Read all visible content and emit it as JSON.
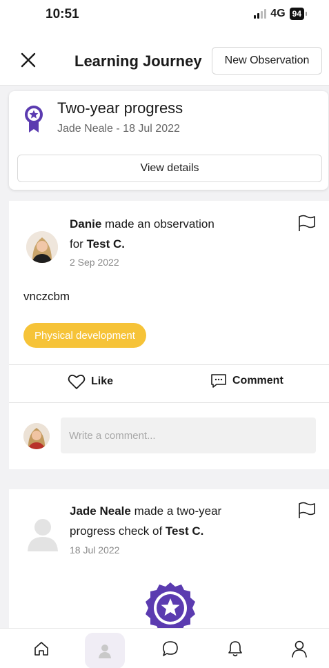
{
  "status_bar": {
    "time": "10:51",
    "network": "4G",
    "battery": "94"
  },
  "header": {
    "title": "Learning Journey",
    "new_observation_label": "New Observation"
  },
  "progress_card": {
    "title": "Two-year progress",
    "subtitle": "Jade Neale - 18 Jul 2022",
    "view_details_label": "View details"
  },
  "observation": {
    "author": "Danie",
    "action_text": " made an observation",
    "for_text": "for ",
    "child": "Test C.",
    "date": "2 Sep 2022",
    "text": "vnczcbm",
    "tag": "Physical development",
    "like_label": "Like",
    "comment_label": "Comment",
    "comment_placeholder": "Write a comment..."
  },
  "progress_check": {
    "author": "Jade Neale",
    "action_text": " made a two-year",
    "line2_text": "progress check of ",
    "child": "Test C.",
    "date": "18 Jul 2022"
  },
  "colors": {
    "accent": "#5b3bb0",
    "tag": "#f6c338",
    "background": "#f2f2f4"
  },
  "icons": {
    "close": "close-icon",
    "flag": "flag-icon",
    "like": "heart-icon",
    "comment": "comment-icon",
    "award": "award-icon",
    "nav": [
      "home-icon",
      "child-profile-icon",
      "chat-icon",
      "bell-icon",
      "user-icon"
    ]
  }
}
